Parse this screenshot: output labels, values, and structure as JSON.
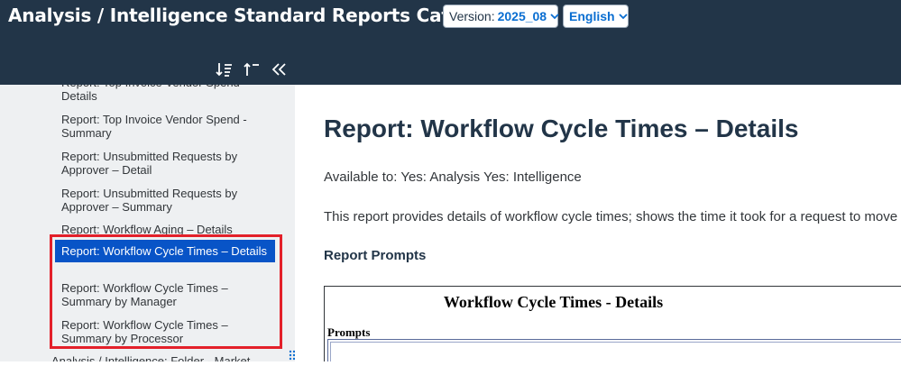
{
  "header": {
    "title": "Analysis / Intelligence Standard Reports Catalog",
    "version_label": "Version:",
    "version_value": "2025_08",
    "language_value": "English"
  },
  "toolbar": {
    "sort_icon": "sort-ascending-icon",
    "top_icon": "sort-top-icon",
    "collapse_icon": "double-chevron-left-icon"
  },
  "sidebar": {
    "items": [
      {
        "label": "Report: Top Invoice Vendor Spend - Details"
      },
      {
        "label": "Report: Top Invoice Vendor Spend - Summary"
      },
      {
        "label": "Report: Unsubmitted Requests by Approver – Detail"
      },
      {
        "label": "Report: Unsubmitted Requests by Approver – Summary"
      },
      {
        "label": "Report: Workflow Aging – Details"
      },
      {
        "label": "Report: Workflow Cycle Times – Details"
      },
      {
        "label": "Report: Workflow Cycle Times – Summary by Manager"
      },
      {
        "label": "Report: Workflow Cycle Times – Summary by Processor"
      },
      {
        "label": "Analysis / Intelligence: Folder - Market"
      }
    ],
    "selected_index": 5
  },
  "content": {
    "title": "Report: Workflow Cycle Times – Details",
    "available": "Available to: Yes: Analysis Yes: Intelligence",
    "description": "This report provides details of workflow cycle times; shows the time it took for a request to move thro",
    "prompts_heading": "Report Prompts",
    "frame_title": "Workflow Cycle Times - Details",
    "frame_prompts": "Prompts"
  },
  "colors": {
    "header_bg": "#223548",
    "selected_bg": "#0854c7",
    "highlight": "#e3202a"
  }
}
